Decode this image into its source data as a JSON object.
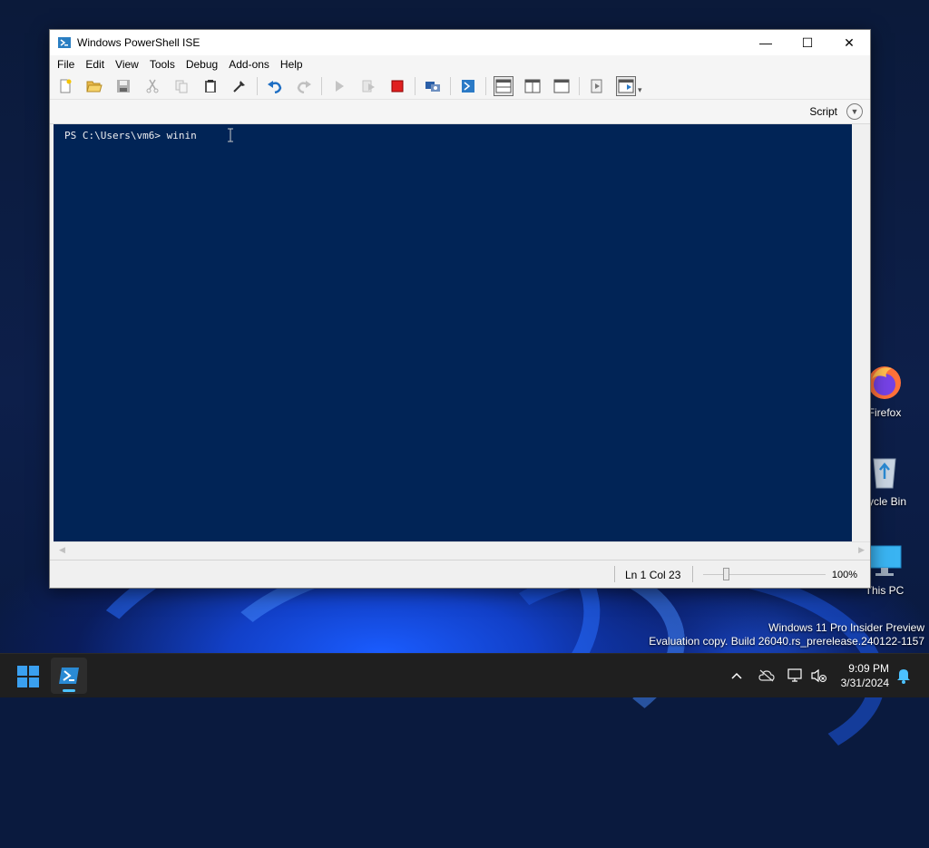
{
  "window": {
    "title": "Windows PowerShell ISE",
    "caption": {
      "minimize": "—",
      "maximize": "☐",
      "close": "✕"
    }
  },
  "menu": [
    "File",
    "Edit",
    "View",
    "Tools",
    "Debug",
    "Add-ons",
    "Help"
  ],
  "toolbar": {
    "icons": [
      "new-script-icon",
      "open-icon",
      "save-icon",
      "cut-icon",
      "copy-icon",
      "paste-icon",
      "clear-console-icon",
      "undo-icon",
      "redo-icon",
      "run-script-icon",
      "run-selection-icon",
      "stop-operation-icon",
      "remote-powershell-tab-icon",
      "start-powershell-exe-icon",
      "show-script-pane-top-icon",
      "show-script-pane-right-icon",
      "show-script-pane-maximized-icon",
      "show-command-window-icon",
      "show-command-addon-icon",
      "toolbar-overflow-icon"
    ]
  },
  "scriptbar": {
    "label": "Script"
  },
  "console": {
    "prompt": "PS C:\\Users\\vm6> ",
    "input": "winin"
  },
  "status": {
    "position": "Ln 1  Col 23",
    "zoom": "100%"
  },
  "desktop": {
    "icons": [
      {
        "label": "Firefox"
      },
      {
        "label": "cycle Bin"
      },
      {
        "label": "This PC"
      }
    ],
    "watermark": {
      "line1": "Windows 11 Pro Insider Preview",
      "line2": "Evaluation copy. Build 26040.rs_prerelease.240122-1157"
    }
  },
  "taskbar": {
    "time": "9:09 PM",
    "date": "3/31/2024"
  },
  "colors": {
    "console_bg": "#012456",
    "console_fg": "#eeedf0",
    "taskbar_bg": "#1f1f1f",
    "accent": "#4cc2ff"
  }
}
